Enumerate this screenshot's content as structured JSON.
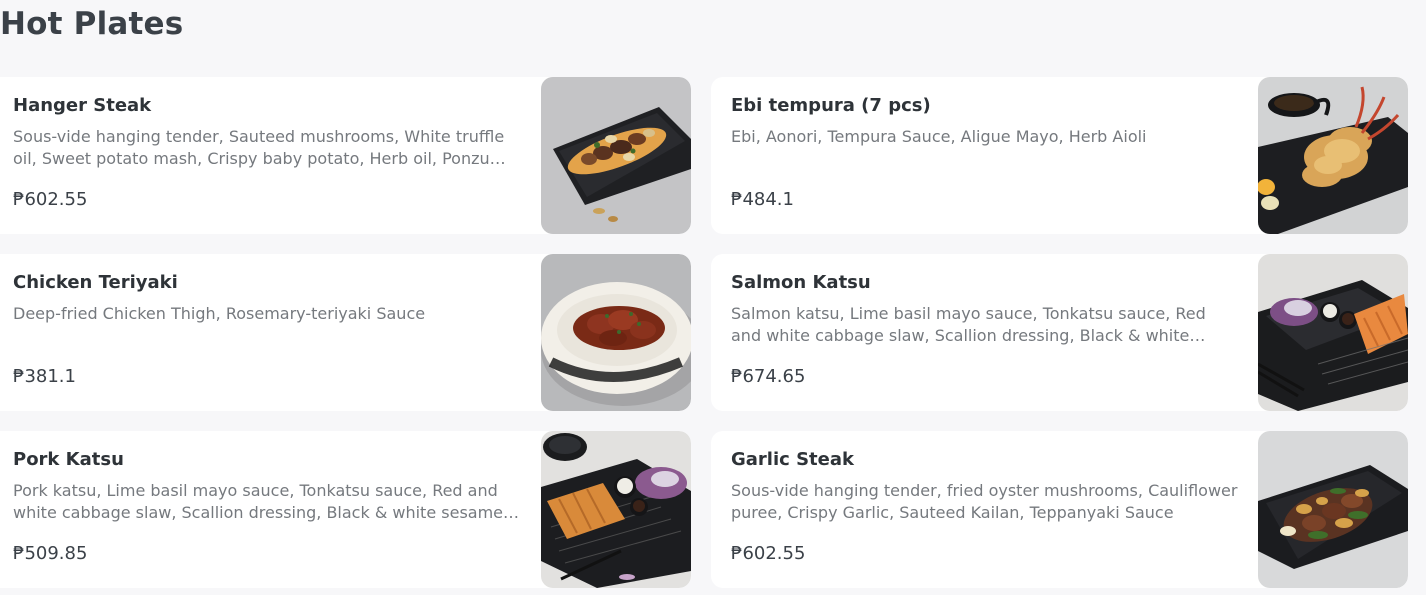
{
  "section": {
    "title": "Hot Plates"
  },
  "currency": "₱",
  "items": [
    {
      "name": "Hanger Steak",
      "description": "Sous-vide hanging tender, Sauteed mushrooms, White truffle oil, Sweet potato mash, Crispy baby potato, Herb oil, Ponzu butter",
      "price": "₱602.55",
      "photo": "steak-plate-photo"
    },
    {
      "name": "Ebi tempura (7 pcs)",
      "description": "Ebi, Aonori, Tempura Sauce, Aligue Mayo, Herb Aioli",
      "price": "₱484.1",
      "photo": "tempura-plate-photo"
    },
    {
      "name": "Chicken Teriyaki",
      "description": "Deep-fried Chicken Thigh, Rosemary-teriyaki Sauce",
      "price": "₱381.1",
      "photo": "teriyaki-bowl-photo"
    },
    {
      "name": "Salmon Katsu",
      "description": "Salmon katsu, Lime basil mayo sauce, Tonkatsu sauce, Red and white cabbage slaw, Scallion dressing, Black & white sesame seeds",
      "price": "₱674.65",
      "photo": "salmon-katsu-tray-photo"
    },
    {
      "name": "Pork Katsu",
      "description": "Pork katsu, Lime basil mayo sauce, Tonkatsu sauce, Red and white cabbage slaw, Scallion dressing, Black & white sesame seeds",
      "price": "₱509.85",
      "photo": "pork-katsu-tray-photo"
    },
    {
      "name": "Garlic Steak",
      "description": "Sous-vide hanging tender, fried oyster mushrooms, Cauliflower puree, Crispy Garlic, Sauteed Kailan, Teppanyaki Sauce",
      "price": "₱602.55",
      "photo": "garlic-steak-plate-photo"
    }
  ],
  "colors": {
    "page_background": "#f7f7f9",
    "card_background": "#ffffff",
    "title_text": "#3b4148",
    "description_text": "#75797e"
  }
}
